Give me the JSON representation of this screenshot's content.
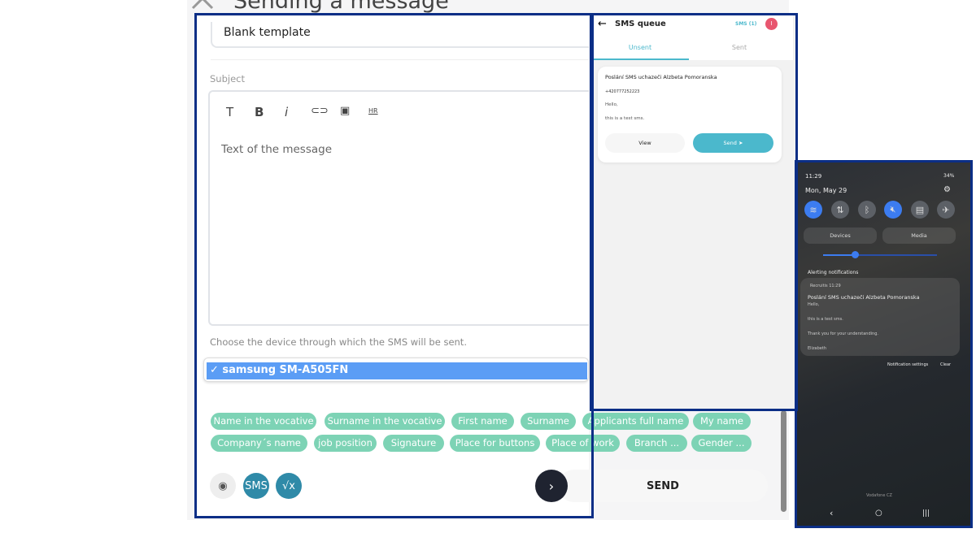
{
  "page": {
    "title": "Sending a message"
  },
  "form": {
    "template_value": "Blank template",
    "subject_label": "Subject",
    "toolbar": [
      "T",
      "B",
      "i",
      "link",
      "image",
      "HR"
    ],
    "body_placeholder": "Text of the message",
    "device_label": "Choose the device through which the SMS will be sent.",
    "device_selected": "✓ samsung SM-A505FN",
    "chips": [
      "Name in the vocative",
      "Surname in the vocative",
      "First name",
      "Surname",
      "Applicants full name",
      "My name",
      "Company´s name",
      "job position",
      "Signature",
      "Place for buttons",
      "Place of work",
      "Branch ...",
      "Gender ..."
    ],
    "preview_icon": "eye-icon",
    "sms_label": "SMS",
    "formula_label": "√x",
    "next_icon": "chevron-right-icon",
    "send_label": "SEND"
  },
  "sms_queue": {
    "title": "SMS queue",
    "badge": "SMS (1)",
    "avatar": "I",
    "tabs": [
      "Unsent",
      "Sent"
    ],
    "card": {
      "title": "Poslání SMS uchazeči Alzbeta Pomoranska",
      "phone": "+420777252223",
      "line1": "Hello,",
      "line2": "this is a test sms.",
      "view": "View",
      "send": "Send"
    },
    "accent": "#4bb8cc",
    "avatar_color": "#e8566f"
  },
  "phone": {
    "time": "11:29",
    "battery": "34%",
    "date": "Mon, May 29",
    "devices": "Devices",
    "media": "Media",
    "alerting": "Alerting notifications",
    "notif": {
      "app": "Recruitis",
      "time": "11:29",
      "title": "Poslání SMS uchazeči Alzbeta Pomoranska",
      "lines": [
        "Hello,",
        "this is a test sms.",
        "Thank you for your understanding.",
        "Elizabeth"
      ]
    },
    "notif_settings": "Notification settings",
    "clear": "Clear",
    "carrier": "Vodafone CZ"
  },
  "colors": {
    "frame": "#0b2e86",
    "chip": "#7dd3b5",
    "select": "#5b9df5",
    "sms_btn": "#2f8aa8"
  }
}
